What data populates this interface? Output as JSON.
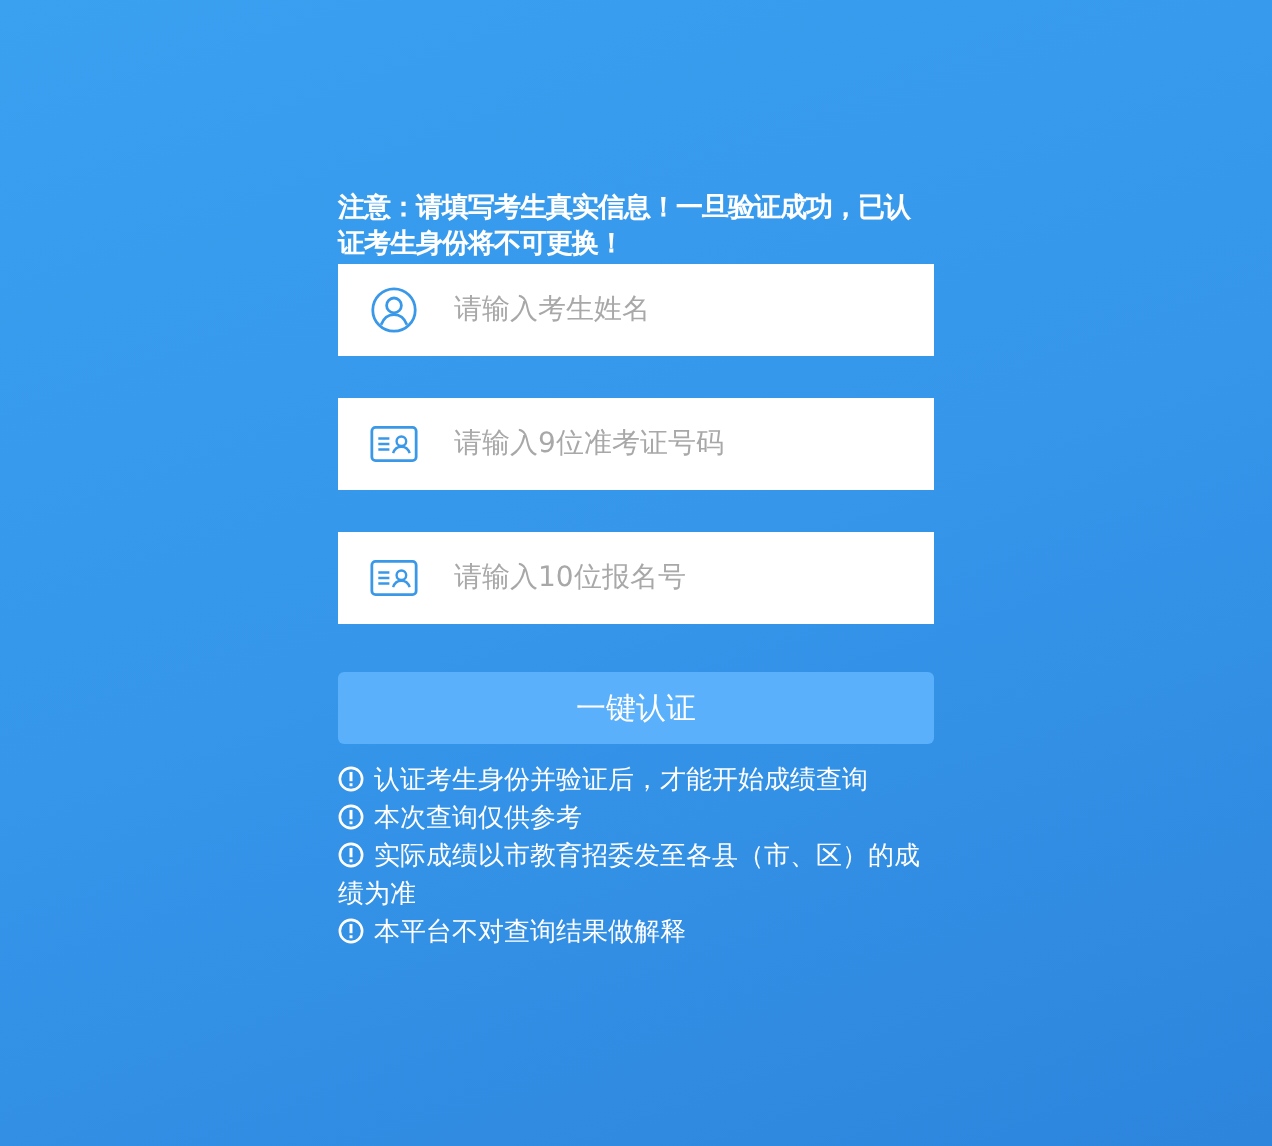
{
  "notice": "注意：请填写考生真实信息！一旦验证成功，已认证考生身份将不可更换！",
  "fields": [
    {
      "kind": "person",
      "placeholder": "请输入考生姓名"
    },
    {
      "kind": "card",
      "placeholder": "请输入9位准考证号码"
    },
    {
      "kind": "card",
      "placeholder": "请输入10位报名号"
    }
  ],
  "submit_button": "一键认证",
  "notes": [
    "认证考生身份并验证后，才能开始成绩查询",
    "本次查询仅供参考",
    "实际成绩以市教育招委发至各县（市、区）的成绩为准",
    "本平台不对查询结果做解释"
  ]
}
